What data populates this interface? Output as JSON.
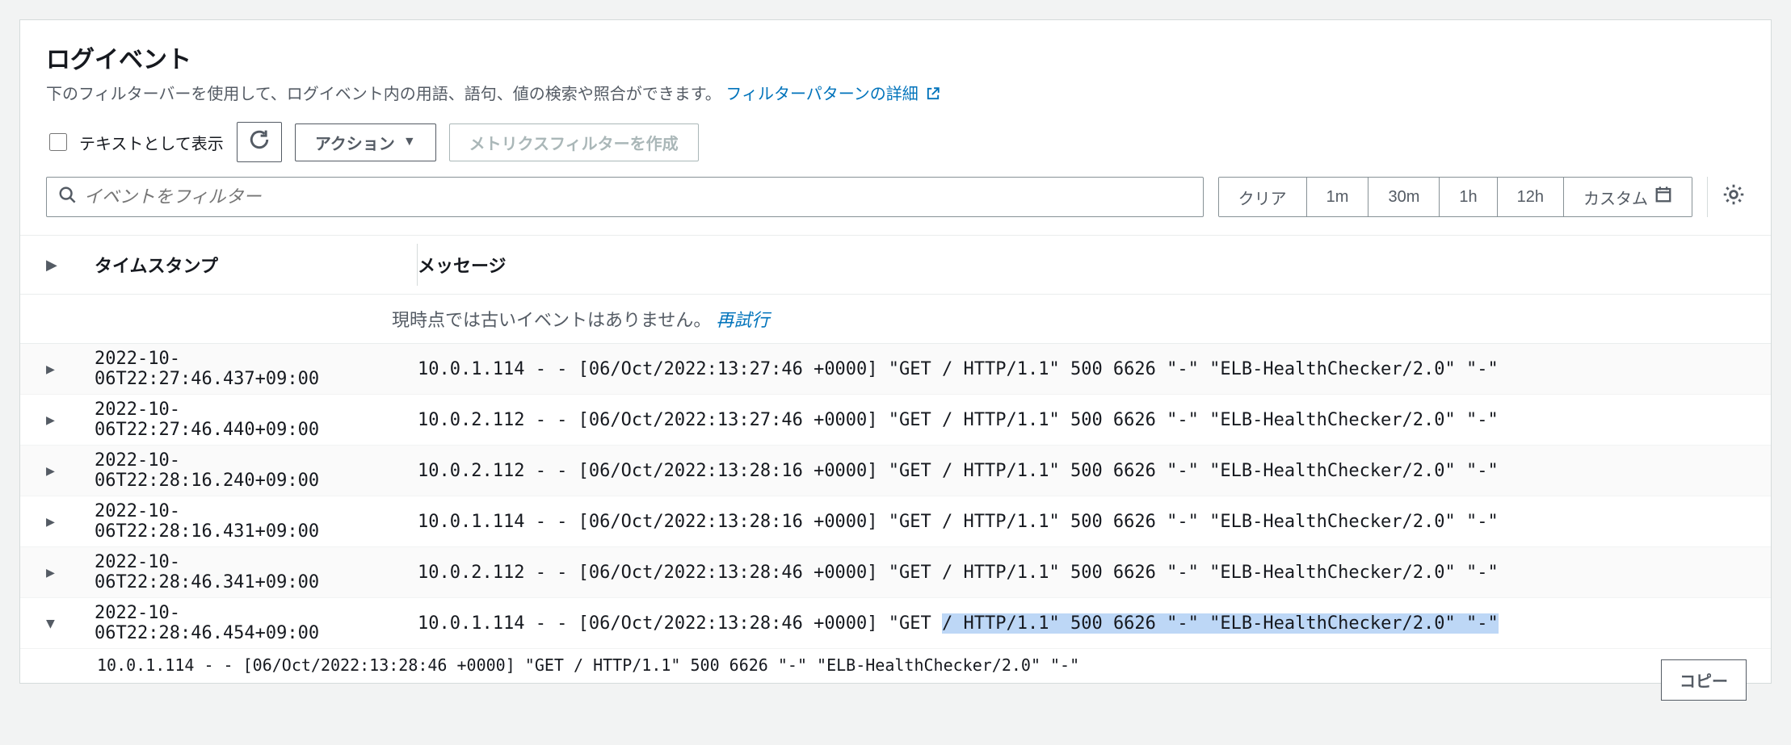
{
  "header": {
    "title": "ログイベント",
    "subtitle_pre": "下のフィルターバーを使用して、ログイベント内の用語、語句、値の検索や照合ができます。 ",
    "link_text": "フィルターパターンの詳細"
  },
  "toolbar": {
    "show_as_text": "テキストとして表示",
    "actions": "アクション",
    "create_metric_filter": "メトリクスフィルターを作成"
  },
  "filter": {
    "placeholder": "イベントをフィルター"
  },
  "time_controls": {
    "clear": "クリア",
    "ranges": [
      "1m",
      "30m",
      "1h",
      "12h"
    ],
    "custom": "カスタム"
  },
  "table": {
    "col_timestamp": "タイムスタンプ",
    "col_message": "メッセージ",
    "no_older_events": "現時点では古いイベントはありません。",
    "retry": "再試行",
    "copy": "コピー"
  },
  "rows": [
    {
      "expanded": false,
      "ts": "2022-10-06T22:27:46.437+09:00",
      "msg": "10.0.1.114 - - [06/Oct/2022:13:27:46 +0000] \"GET / HTTP/1.1\" 500 6626 \"-\" \"ELB-HealthChecker/2.0\" \"-\""
    },
    {
      "expanded": false,
      "ts": "2022-10-06T22:27:46.440+09:00",
      "msg": "10.0.2.112 - - [06/Oct/2022:13:27:46 +0000] \"GET / HTTP/1.1\" 500 6626 \"-\" \"ELB-HealthChecker/2.0\" \"-\""
    },
    {
      "expanded": false,
      "ts": "2022-10-06T22:28:16.240+09:00",
      "msg": "10.0.2.112 - - [06/Oct/2022:13:28:16 +0000] \"GET / HTTP/1.1\" 500 6626 \"-\" \"ELB-HealthChecker/2.0\" \"-\""
    },
    {
      "expanded": false,
      "ts": "2022-10-06T22:28:16.431+09:00",
      "msg": "10.0.1.114 - - [06/Oct/2022:13:28:16 +0000] \"GET / HTTP/1.1\" 500 6626 \"-\" \"ELB-HealthChecker/2.0\" \"-\""
    },
    {
      "expanded": false,
      "ts": "2022-10-06T22:28:46.341+09:00",
      "msg": "10.0.2.112 - - [06/Oct/2022:13:28:46 +0000] \"GET / HTTP/1.1\" 500 6626 \"-\" \"ELB-HealthChecker/2.0\" \"-\""
    },
    {
      "expanded": true,
      "ts": "2022-10-06T22:28:46.454+09:00",
      "msg_pre": "10.0.1.114 - - [06/Oct/2022:13:28:46 +0000] \"GET ",
      "msg_hl": "/ HTTP/1.1\" 500 6626 \"-\" \"ELB-HealthChecker/2.0\" \"-\"",
      "detail": "10.0.1.114 - - [06/Oct/2022:13:28:46 +0000] \"GET / HTTP/1.1\" 500 6626 \"-\" \"ELB-HealthChecker/2.0\" \"-\""
    }
  ]
}
